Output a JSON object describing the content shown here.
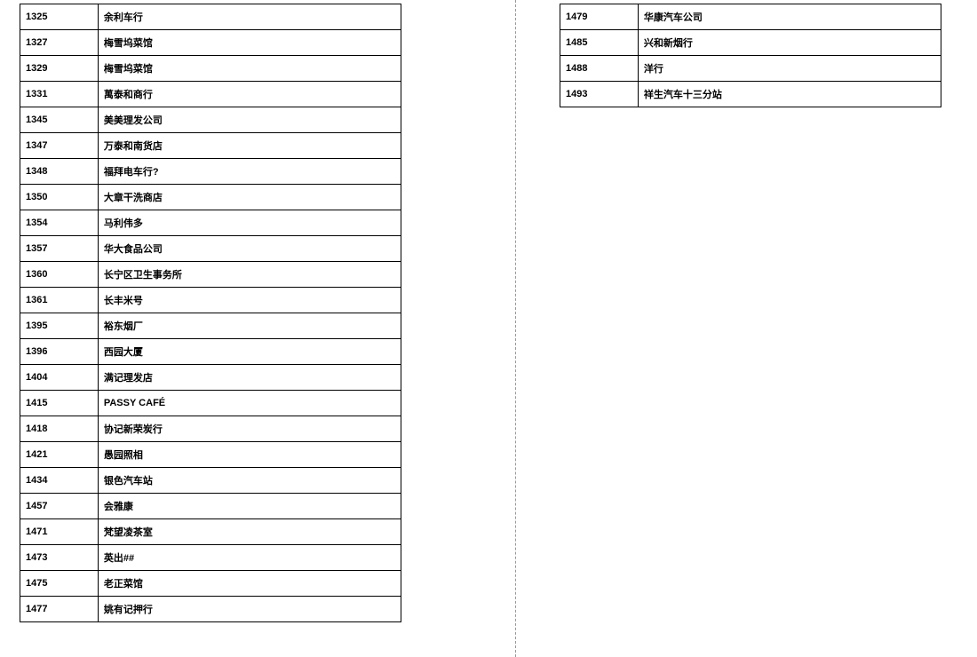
{
  "left_rows": [
    {
      "num": "1325",
      "name": "余利车行"
    },
    {
      "num": "1327",
      "name": "梅雪坞菜馆"
    },
    {
      "num": "1329",
      "name": "梅雪坞菜馆"
    },
    {
      "num": "1331",
      "name": "萬泰和商行"
    },
    {
      "num": "1345",
      "name": "美美理发公司"
    },
    {
      "num": "1347",
      "name": "万泰和南货店"
    },
    {
      "num": "1348",
      "name": "福拜电车行?"
    },
    {
      "num": "1350",
      "name": "大章干洗商店"
    },
    {
      "num": "1354",
      "name": "马利伟多"
    },
    {
      "num": "1357",
      "name": "华大食品公司"
    },
    {
      "num": "1360",
      "name": "长宁区卫生事务所"
    },
    {
      "num": "1361",
      "name": "长丰米号"
    },
    {
      "num": "1395",
      "name": "裕东烟厂"
    },
    {
      "num": "1396",
      "name": "西园大厦"
    },
    {
      "num": "1404",
      "name": "满记理发店"
    },
    {
      "num": "1415",
      "name": "PASSY CAFÉ"
    },
    {
      "num": "1418",
      "name": "协记新荣炭行"
    },
    {
      "num": "1421",
      "name": "愚园照相"
    },
    {
      "num": "1434",
      "name": "银色汽车站"
    },
    {
      "num": "1457",
      "name": "会雅康"
    },
    {
      "num": "1471",
      "name": "梵望凌茶室"
    },
    {
      "num": "1473",
      "name": "英出##"
    },
    {
      "num": "1475",
      "name": "老正菜馆"
    },
    {
      "num": "1477",
      "name": "姚有记押行"
    }
  ],
  "right_rows": [
    {
      "num": "1479",
      "name": " 华康汽车公司"
    },
    {
      "num": "1485",
      "name": "兴和新烟行"
    },
    {
      "num": "1488",
      "name": "洋行"
    },
    {
      "num": "1493",
      "name": "祥生汽车十三分站"
    }
  ]
}
